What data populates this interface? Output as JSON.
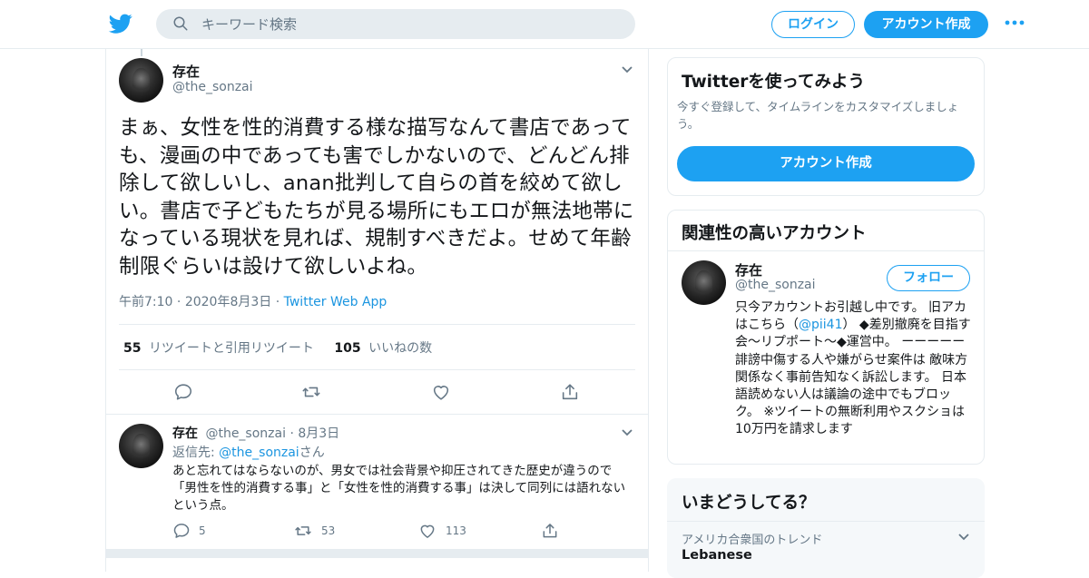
{
  "header": {
    "search_placeholder": "キーワード検索",
    "login_label": "ログイン",
    "signup_label": "アカウント作成"
  },
  "tweet": {
    "name": "存在",
    "handle": "@the_sonzai",
    "text": "まぁ、女性を性的消費する様な描写なんて書店であっても、漫画の中であっても害でしかないので、どんどん排除して欲しいし、anan批判して自らの首を絞めて欲しい。書店で子どもたちが見る場所にもエロが無法地帯になっている現状を見れば、規制すべきだよ。せめて年齢制限ぐらいは設けて欲しいよね。",
    "time": "午前7:10",
    "date": "2020年8月3日",
    "source": "Twitter Web App",
    "retweet_count": "55",
    "retweet_label": "リツイートと引用リツイート",
    "like_count": "105",
    "like_label": "いいねの数"
  },
  "reply": {
    "name": "存在",
    "handle": "@the_sonzai",
    "date": "8月3日",
    "reply_to_prefix": "返信先: ",
    "reply_to_handle": "@the_sonzai",
    "reply_to_suffix": "さん",
    "text": "あと忘れてはならないのが、男女では社会背景や抑圧されてきた歴史が違うので「男性を性的消費する事」と「女性を性的消費する事」は決して同列には語れないという点。",
    "reply_count": "5",
    "retweet_count": "53",
    "like_count": "113"
  },
  "sidebar": {
    "signup_card": {
      "title": "Twitterを使ってみよう",
      "subtitle": "今すぐ登録して、タイムラインをカスタマイズしましょう。",
      "button": "アカウント作成"
    },
    "related_card": {
      "title": "関連性の高いアカウント",
      "name": "存在",
      "handle": "@the_sonzai",
      "follow_label": "フォロー",
      "bio_before": "只今アカウントお引越し中です。 旧アカはこちら（",
      "bio_link": "@pii41",
      "bio_after": "） ◆差別撤廃を目指す会〜リプポート〜◆運営中。 ーーーーー 誹謗中傷する人や嫌がらせ案件は 敵味方関係なく事前告知なく訴訟します。 日本語読めない人は議論の途中でもブロック。 ※ツイートの無断利用やスクショは10万円を請求します"
    },
    "trends_card": {
      "title": "いまどうしてる？",
      "trend_label": "アメリカ合衆国のトレンド",
      "trend_name": "Lebanese"
    }
  },
  "colors": {
    "brand": "#1da1f2",
    "link": "#1b95e0",
    "muted": "#657786",
    "border": "#e6ecf0"
  },
  "icons": [
    "twitter-bird-icon",
    "search-icon",
    "more-icon",
    "chevron-down-icon",
    "reply-icon",
    "retweet-icon",
    "like-icon",
    "share-icon"
  ]
}
